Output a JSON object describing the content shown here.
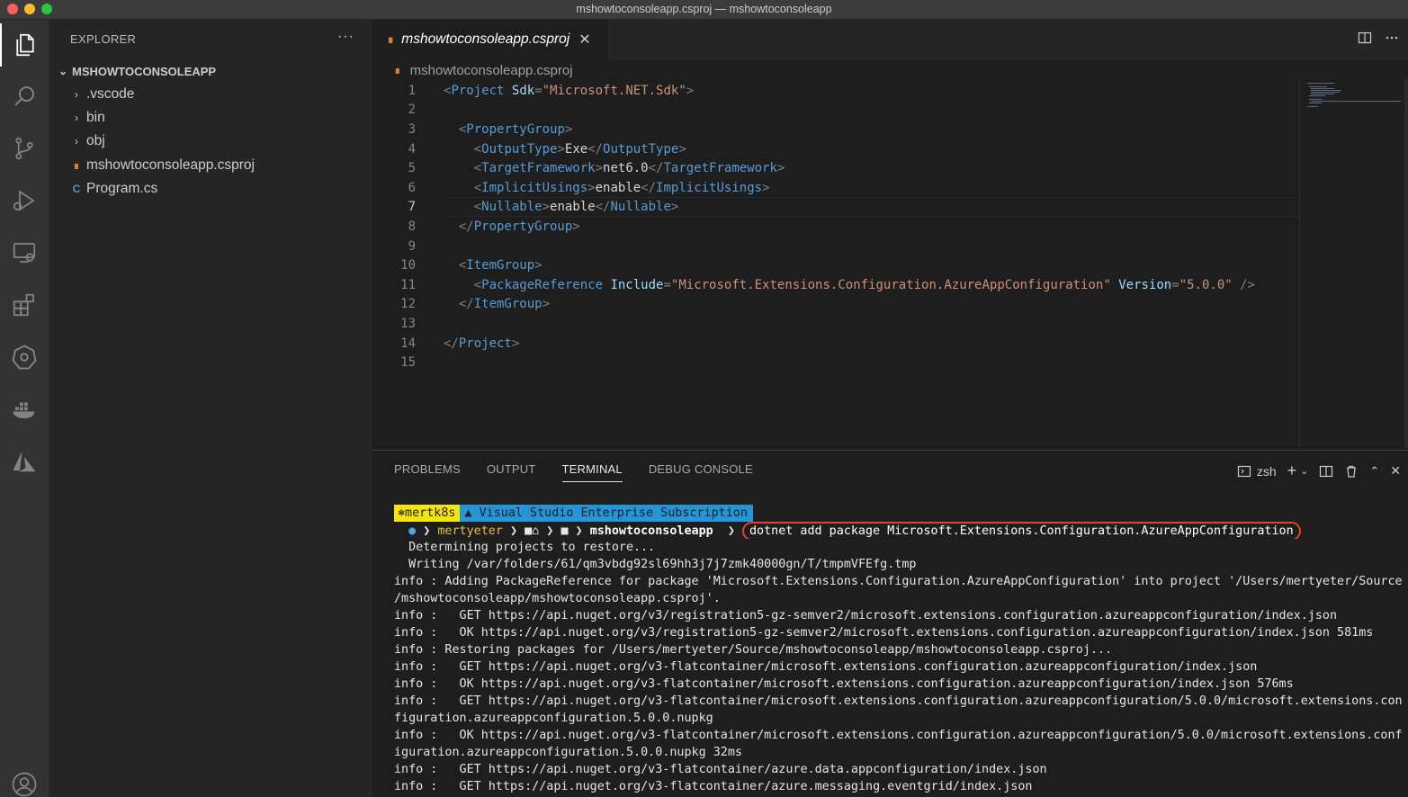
{
  "window": {
    "title": "mshowtoconsoleapp.csproj — mshowtoconsoleapp"
  },
  "activity_bar": {
    "items": [
      "explorer-icon",
      "search-icon",
      "source-control-icon",
      "run-debug-icon",
      "remote-explorer-icon",
      "extensions-icon",
      "kubernetes-icon",
      "docker-icon",
      "azure-icon",
      "account-icon"
    ]
  },
  "sidebar": {
    "title": "EXPLORER",
    "more": "···",
    "root_folder": "MSHOWTOCONSOLEAPP",
    "items": [
      {
        "label": ".vscode",
        "kind": "folder"
      },
      {
        "label": "bin",
        "kind": "folder"
      },
      {
        "label": "obj",
        "kind": "folder"
      },
      {
        "label": "mshowtoconsoleapp.csproj",
        "kind": "csproj"
      },
      {
        "label": "Program.cs",
        "kind": "csharp"
      }
    ]
  },
  "editor": {
    "tab_label": "mshowtoconsoleapp.csproj",
    "breadcrumb": "mshowtoconsoleapp.csproj",
    "current_line": 7,
    "lines": [
      {
        "n": "1",
        "tokens": [
          [
            "p",
            "<"
          ],
          [
            "t",
            "Project"
          ],
          [
            "x",
            " "
          ],
          [
            "a",
            "Sdk"
          ],
          [
            "p",
            "="
          ],
          [
            "s",
            "\"Microsoft.NET.Sdk\""
          ],
          [
            "p",
            ">"
          ]
        ]
      },
      {
        "n": "2",
        "tokens": []
      },
      {
        "n": "3",
        "tokens": [
          [
            "x",
            "  "
          ],
          [
            "p",
            "<"
          ],
          [
            "t",
            "PropertyGroup"
          ],
          [
            "p",
            ">"
          ]
        ]
      },
      {
        "n": "4",
        "tokens": [
          [
            "x",
            "    "
          ],
          [
            "p",
            "<"
          ],
          [
            "t",
            "OutputType"
          ],
          [
            "p",
            ">"
          ],
          [
            "x",
            "Exe"
          ],
          [
            "p",
            "</"
          ],
          [
            "t",
            "OutputType"
          ],
          [
            "p",
            ">"
          ]
        ]
      },
      {
        "n": "5",
        "tokens": [
          [
            "x",
            "    "
          ],
          [
            "p",
            "<"
          ],
          [
            "t",
            "TargetFramework"
          ],
          [
            "p",
            ">"
          ],
          [
            "x",
            "net6.0"
          ],
          [
            "p",
            "</"
          ],
          [
            "t",
            "TargetFramework"
          ],
          [
            "p",
            ">"
          ]
        ]
      },
      {
        "n": "6",
        "tokens": [
          [
            "x",
            "    "
          ],
          [
            "p",
            "<"
          ],
          [
            "t",
            "ImplicitUsings"
          ],
          [
            "p",
            ">"
          ],
          [
            "x",
            "enable"
          ],
          [
            "p",
            "</"
          ],
          [
            "t",
            "ImplicitUsings"
          ],
          [
            "p",
            ">"
          ]
        ]
      },
      {
        "n": "7",
        "tokens": [
          [
            "x",
            "    "
          ],
          [
            "p",
            "<"
          ],
          [
            "t",
            "Nullable"
          ],
          [
            "p",
            ">"
          ],
          [
            "x",
            "enable"
          ],
          [
            "p",
            "</"
          ],
          [
            "t",
            "Nullable"
          ],
          [
            "p",
            ">"
          ]
        ]
      },
      {
        "n": "8",
        "tokens": [
          [
            "x",
            "  "
          ],
          [
            "p",
            "</"
          ],
          [
            "t",
            "PropertyGroup"
          ],
          [
            "p",
            ">"
          ]
        ]
      },
      {
        "n": "9",
        "tokens": []
      },
      {
        "n": "10",
        "tokens": [
          [
            "x",
            "  "
          ],
          [
            "p",
            "<"
          ],
          [
            "t",
            "ItemGroup"
          ],
          [
            "p",
            ">"
          ]
        ]
      },
      {
        "n": "11",
        "tokens": [
          [
            "x",
            "    "
          ],
          [
            "p",
            "<"
          ],
          [
            "t",
            "PackageReference"
          ],
          [
            "x",
            " "
          ],
          [
            "a",
            "Include"
          ],
          [
            "p",
            "="
          ],
          [
            "s",
            "\"Microsoft.Extensions.Configuration.AzureAppConfiguration\""
          ],
          [
            "x",
            " "
          ],
          [
            "a",
            "Version"
          ],
          [
            "p",
            "="
          ],
          [
            "s",
            "\"5.0.0\""
          ],
          [
            "x",
            " "
          ],
          [
            "p",
            "/>"
          ]
        ]
      },
      {
        "n": "12",
        "tokens": [
          [
            "x",
            "  "
          ],
          [
            "p",
            "</"
          ],
          [
            "t",
            "ItemGroup"
          ],
          [
            "p",
            ">"
          ]
        ]
      },
      {
        "n": "13",
        "tokens": []
      },
      {
        "n": "14",
        "tokens": [
          [
            "p",
            "</"
          ],
          [
            "t",
            "Project"
          ],
          [
            "p",
            ">"
          ]
        ]
      },
      {
        "n": "15",
        "tokens": []
      }
    ]
  },
  "panel": {
    "tabs": [
      "PROBLEMS",
      "OUTPUT",
      "TERMINAL",
      "DEBUG CONSOLE"
    ],
    "active_tab": "TERMINAL",
    "shell": "zsh",
    "terminal": {
      "prompt_k8s": "⎈mertk8s",
      "prompt_subscription": "Visual Studio Enterprise Subscription",
      "prompt_user": "mertyeter",
      "prompt_dir": "mshowtoconsoleapp",
      "command": "dotnet add package Microsoft.Extensions.Configuration.AzureAppConfiguration",
      "output": [
        "  Determining projects to restore...",
        "  Writing /var/folders/61/qm3vbdg92sl69hh3j7j7zmk40000gn/T/tmpmVFEfg.tmp",
        "info : Adding PackageReference for package 'Microsoft.Extensions.Configuration.AzureAppConfiguration' into project '/Users/mertyeter/Source",
        "/mshowtoconsoleapp/mshowtoconsoleapp.csproj'.",
        "info :   GET https://api.nuget.org/v3/registration5-gz-semver2/microsoft.extensions.configuration.azureappconfiguration/index.json",
        "info :   OK https://api.nuget.org/v3/registration5-gz-semver2/microsoft.extensions.configuration.azureappconfiguration/index.json 581ms",
        "info : Restoring packages for /Users/mertyeter/Source/mshowtoconsoleapp/mshowtoconsoleapp.csproj...",
        "info :   GET https://api.nuget.org/v3-flatcontainer/microsoft.extensions.configuration.azureappconfiguration/index.json",
        "info :   OK https://api.nuget.org/v3-flatcontainer/microsoft.extensions.configuration.azureappconfiguration/index.json 576ms",
        "info :   GET https://api.nuget.org/v3-flatcontainer/microsoft.extensions.configuration.azureappconfiguration/5.0.0/microsoft.extensions.con",
        "figuration.azureappconfiguration.5.0.0.nupkg",
        "info :   OK https://api.nuget.org/v3-flatcontainer/microsoft.extensions.configuration.azureappconfiguration/5.0.0/microsoft.extensions.conf",
        "iguration.azureappconfiguration.5.0.0.nupkg 32ms",
        "info :   GET https://api.nuget.org/v3-flatcontainer/azure.data.appconfiguration/index.json",
        "info :   GET https://api.nuget.org/v3-flatcontainer/azure.messaging.eventgrid/index.json"
      ]
    }
  },
  "colors": {
    "highlight_box": "#e0432d",
    "k8s_segment": "#f5e50a",
    "subscription_segment": "#2496d8"
  }
}
